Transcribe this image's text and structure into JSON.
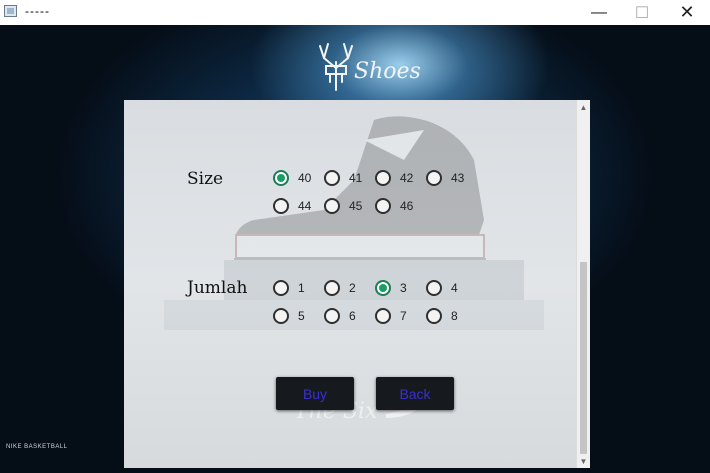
{
  "window": {
    "title": "-----",
    "minimize_glyph": "—",
    "maximize_glyph": "☐",
    "close_glyph": "✕"
  },
  "brand": {
    "logo_text": "Shoes",
    "footer_mark": "NIKE BASKETBALL",
    "watermark_text": "The Six"
  },
  "form": {
    "size": {
      "label": "Size",
      "options": [
        "40",
        "41",
        "42",
        "43",
        "44",
        "45",
        "46"
      ],
      "selected": "40"
    },
    "jumlah": {
      "label": "Jumlah",
      "options": [
        "1",
        "2",
        "3",
        "4",
        "5",
        "6",
        "7",
        "8"
      ],
      "selected": "3"
    }
  },
  "actions": {
    "buy_label": "Buy",
    "back_label": "Back"
  },
  "scrollbar": {
    "up_glyph": "▲",
    "down_glyph": "▼"
  },
  "colors": {
    "radio_checked": "#1a9e63",
    "button_bg": "#161a1e",
    "button_text": "#3a2fd0"
  }
}
